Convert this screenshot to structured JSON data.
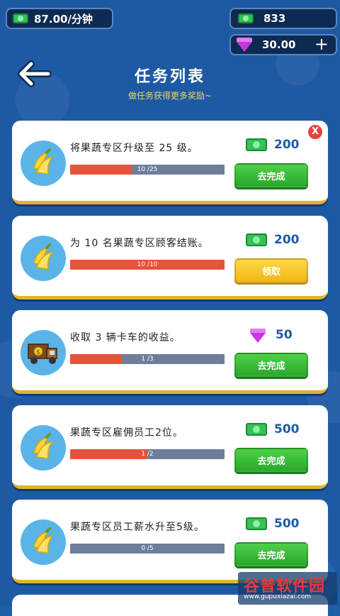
{
  "header": {
    "rate": "87.00/分钟",
    "cash": "833",
    "gems": "30.00",
    "plus_label": "+",
    "title": "任务列表",
    "subtitle": "做任务获得更多奖励~"
  },
  "tasks": [
    {
      "description": "将果蔬专区升级至 25 级。",
      "progress_text": "10 /25",
      "progress": 0.4,
      "reward_type": "cash",
      "reward": "200",
      "button": "去完成",
      "button_style": "green",
      "icon": "banana-icon"
    },
    {
      "description": "为 10 名果蔬专区顾客结账。",
      "progress_text": "10 /10",
      "progress": 1.0,
      "reward_type": "cash",
      "reward": "200",
      "button": "领取",
      "button_style": "yellow",
      "icon": "banana-icon"
    },
    {
      "description": "收取 3 辆卡车的收益。",
      "progress_text": "1 /3",
      "progress": 0.3333,
      "reward_type": "gem",
      "reward": "50",
      "button": "去完成",
      "button_style": "green",
      "icon": "truck-icon"
    },
    {
      "description": "果蔬专区雇佣员工2位。",
      "progress_text": "1 /2",
      "progress": 0.5,
      "reward_type": "cash",
      "reward": "500",
      "button": "去完成",
      "button_style": "green",
      "icon": "banana-icon"
    },
    {
      "description": "果蔬专区员工薪水升至5级。",
      "progress_text": "0 /5",
      "progress": 0.0,
      "reward_type": "cash",
      "reward": "500",
      "button": "去完成",
      "button_style": "green",
      "icon": "banana-icon"
    }
  ],
  "close_label": "X",
  "watermark": {
    "main": "谷普软件园",
    "url": "www.gupuxiazai.com"
  },
  "colors": {
    "background": "#1e5aa3",
    "progress_fill": "#e5533a",
    "progress_track": "#6e7e99",
    "green_button": "#2aa82a",
    "yellow_button": "#f2b716"
  }
}
